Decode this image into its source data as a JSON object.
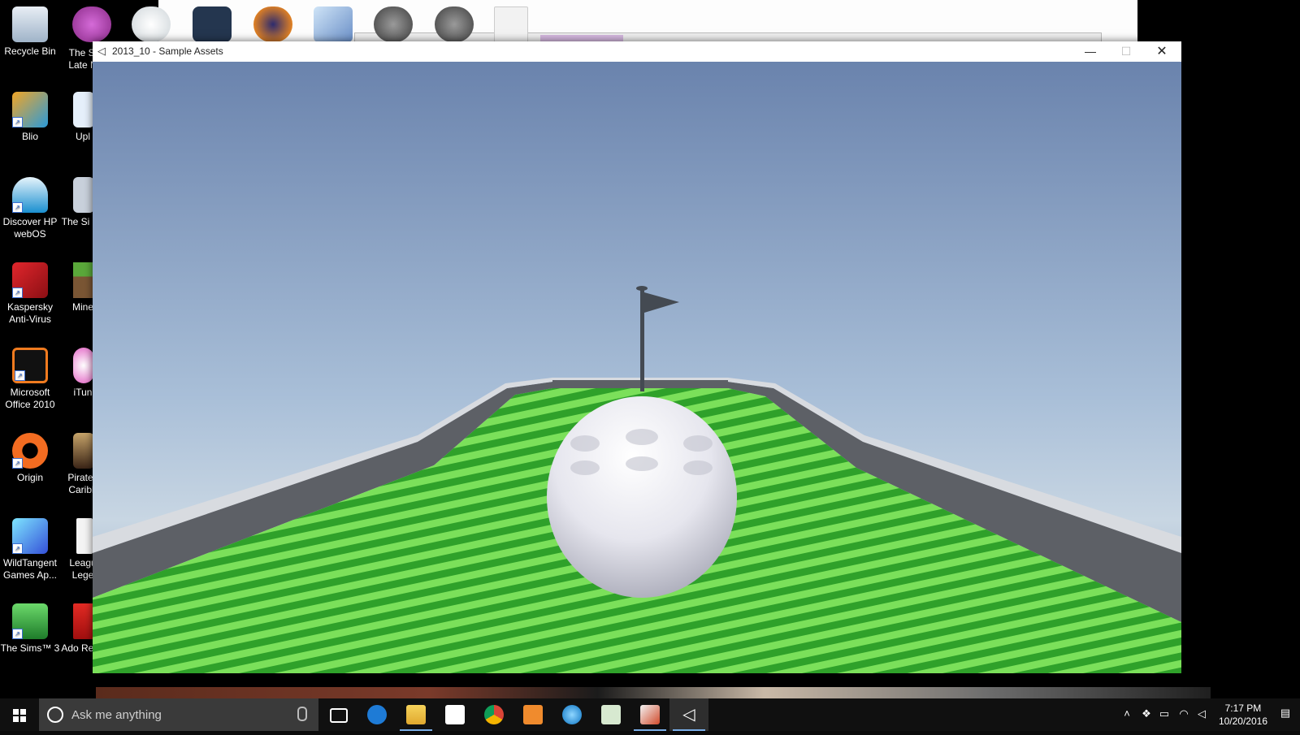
{
  "desktop": {
    "icons_left": [
      {
        "label": "Recycle Bin",
        "icon": "recycle-bin-icon"
      },
      {
        "label": "Blio",
        "icon": "blio-icon"
      },
      {
        "label": "Discover HP webOS",
        "icon": "hp-webos-icon"
      },
      {
        "label": "Kaspersky Anti-Virus",
        "icon": "kaspersky-icon"
      },
      {
        "label": "Microsoft Office 2010",
        "icon": "office-icon"
      },
      {
        "label": "Origin",
        "icon": "origin-icon"
      },
      {
        "label": "WildTangent Games Ap...",
        "icon": "wildtangent-icon"
      },
      {
        "label": "The Sims™ 3",
        "icon": "sims-icon"
      }
    ],
    "icons_col2": [
      {
        "label": "The Si Late N",
        "icon": "sims-icon"
      },
      {
        "label": "Upl",
        "icon": "uplay-icon"
      },
      {
        "label": "The Si Pe",
        "icon": "sims-icon"
      },
      {
        "label": "Mine",
        "icon": "minecraft-icon"
      },
      {
        "label": "iTun",
        "icon": "itunes-icon"
      },
      {
        "label": "Pirates Caribb",
        "icon": "pirates-icon"
      },
      {
        "label": "Leagu Lege",
        "icon": "league-icon"
      },
      {
        "label": "Ado Read",
        "icon": "adobe-reader-icon"
      }
    ]
  },
  "window": {
    "title": "2013_10 - Sample Assets",
    "app_icon": "unity-icon",
    "minimize_glyph": "—",
    "maximize_glyph": "☐",
    "close_glyph": "✕"
  },
  "scene": {
    "sky_top": "#6d86b0",
    "sky_horizon": "#c7d6e4",
    "grass_light": "#7be05a",
    "grass_dark": "#2fa12a",
    "ball_color": "#e9e9ef",
    "flag_color": "#444a52",
    "wall_top": "#d8dbe0",
    "wall_side": "#5d6066"
  },
  "taskbar": {
    "search_placeholder": "Ask me anything",
    "apps": [
      {
        "name": "task-view-icon"
      },
      {
        "name": "edge-icon"
      },
      {
        "name": "file-explorer-icon"
      },
      {
        "name": "store-icon"
      },
      {
        "name": "chrome-icon"
      },
      {
        "name": "media-player-icon"
      },
      {
        "name": "hp-support-icon"
      },
      {
        "name": "hp-store-icon"
      },
      {
        "name": "cards-icon"
      },
      {
        "name": "unity-icon"
      }
    ],
    "time": "7:17 PM",
    "date": "10/20/2016"
  }
}
